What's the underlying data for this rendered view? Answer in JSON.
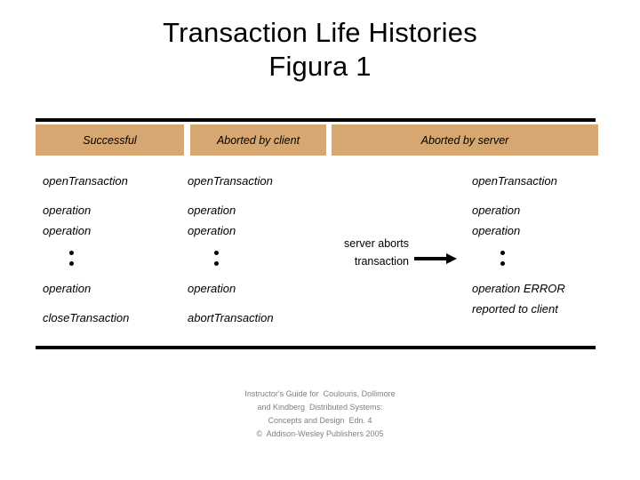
{
  "title": {
    "line1": "Transaction Life Histories",
    "line2": "Figura 1"
  },
  "table": {
    "headers": [
      {
        "label": "Successful"
      },
      {
        "label": "Aborted by client"
      },
      {
        "label": "Aborted by server"
      }
    ],
    "columns": {
      "successful": {
        "line1": "openTransaction",
        "line2": "operation",
        "line3": "operation",
        "line4": "operation",
        "line5": "closeTransaction"
      },
      "aborted_by_client": {
        "line1": "openTransaction",
        "line2": "operation",
        "line3": "operation",
        "line4": "operation",
        "line5": "abortTransaction"
      },
      "aborted_by_server": {
        "line1": "openTransaction",
        "line2": "operation",
        "line3": "operation",
        "line4": "operation ERROR",
        "line5": "reported to client"
      }
    }
  },
  "annotation": {
    "server_abort_line1": "server aborts",
    "server_abort_line2": "transaction"
  },
  "footer": {
    "line1": "Instructor's Guide for  Coulouris, Dollimore",
    "line2": "and Kindberg  Distributed Systems:",
    "line3": "Concepts and Design  Edn. 4",
    "line4": "©  Addison-Wesley Publishers 2005"
  },
  "colors": {
    "header_band": "#d6a771",
    "rule": "#000000",
    "footer_text": "#808080"
  }
}
